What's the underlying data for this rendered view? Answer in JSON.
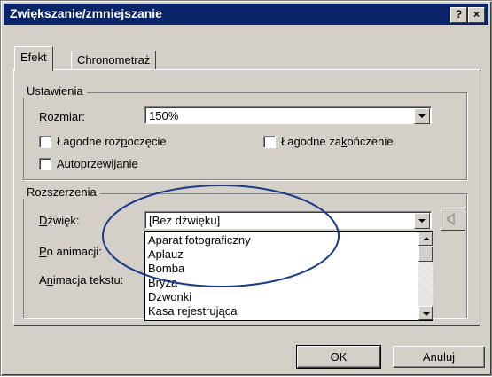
{
  "window": {
    "title": "Zwiększanie/zmniejszanie",
    "help_glyph": "?",
    "close_glyph": "×"
  },
  "tabs": [
    {
      "label": "Efekt"
    },
    {
      "label": "Chronometraż"
    }
  ],
  "ustawienia": {
    "label": "Ustawienia",
    "rozmiar": {
      "pre": "",
      "key": "R",
      "post": "ozmiar:",
      "value": "150%"
    },
    "lagodne_rozpoczecie": {
      "pre": "Łagodne roz",
      "key": "p",
      "post": "oczęcie",
      "checked": false
    },
    "lagodne_zakonczenie": {
      "pre": "Łagodne za",
      "key": "k",
      "post": "ończenie",
      "checked": false
    },
    "autoprzewijanie": {
      "pre": "A",
      "key": "u",
      "post": "toprzewijanie",
      "checked": false
    }
  },
  "rozszerzenia": {
    "label": "Rozszerzenia",
    "dzwiek": {
      "pre": "",
      "key": "D",
      "post": "źwięk:",
      "value": "[Bez dźwięku]"
    },
    "po_animacji": {
      "pre": "",
      "key": "P",
      "post": "o animacji:"
    },
    "animacja_tekstu": {
      "pre": "A",
      "key": "n",
      "post": "imacja tekstu:"
    },
    "options": [
      "Aparat fotograficzny",
      "Aplauz",
      "Bomba",
      "Bryza",
      "Dzwonki",
      "Kasa rejestrująca"
    ]
  },
  "buttons": {
    "ok": "OK",
    "cancel": "Anuluj"
  },
  "colors": {
    "titlebar": "#0a246a",
    "face": "#d4d0c8",
    "annotation": "#1a3b8c"
  }
}
